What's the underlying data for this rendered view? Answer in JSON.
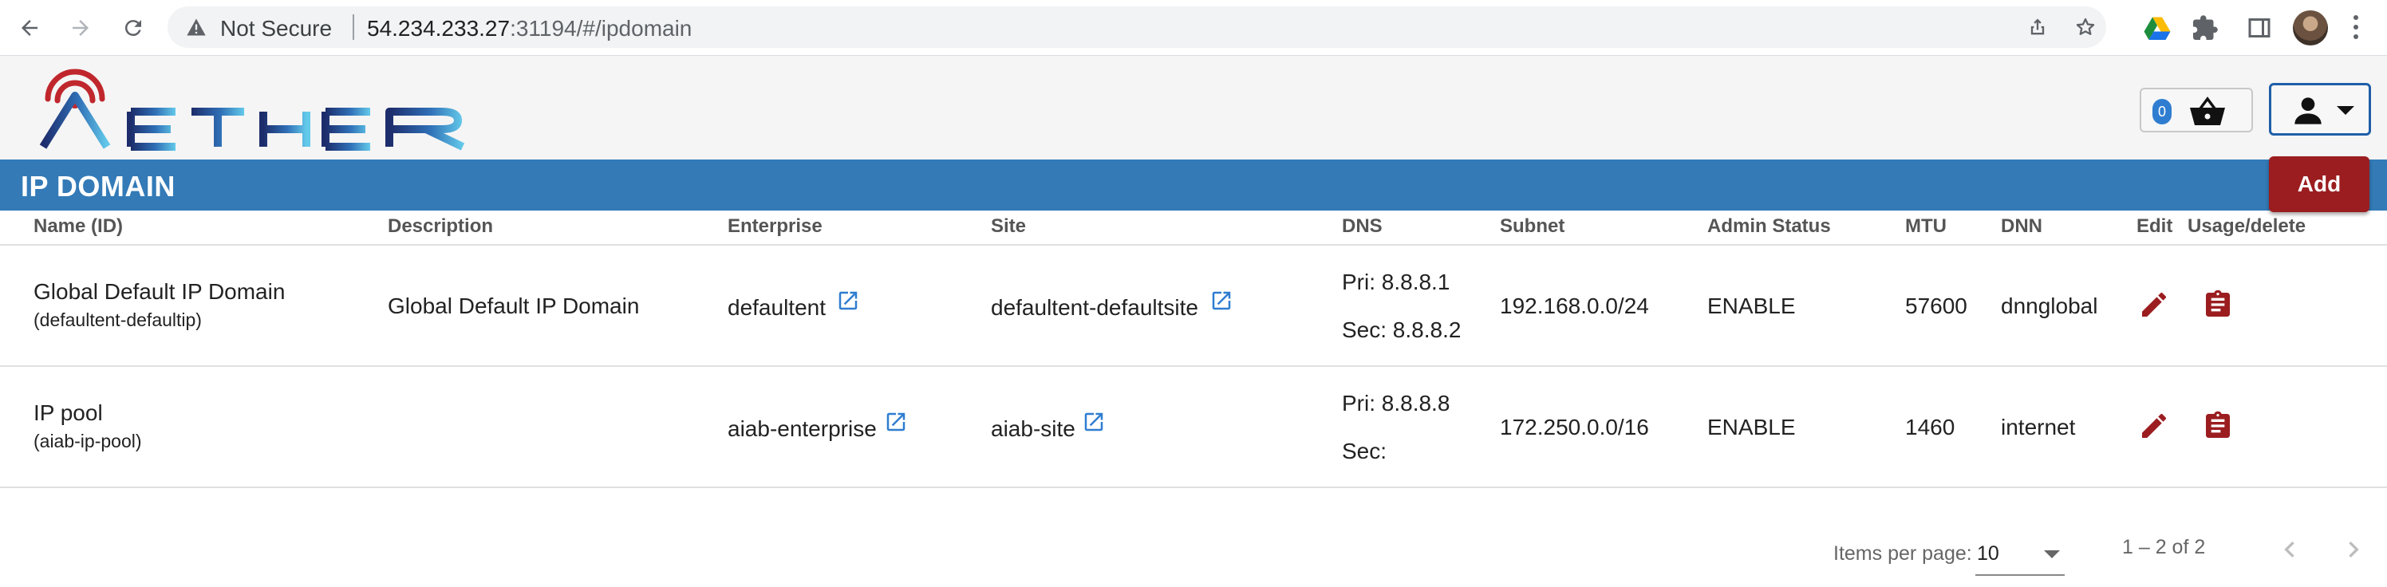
{
  "browser": {
    "security_label": "Not Secure",
    "url_host": "54.234.233.27",
    "url_rest": ":31194/#/ipdomain"
  },
  "header": {
    "logo_text": "AETHER",
    "cart_count": "0"
  },
  "page": {
    "title": "IP DOMAIN",
    "add_label": "Add"
  },
  "table": {
    "columns": {
      "name": "Name (ID)",
      "description": "Description",
      "enterprise": "Enterprise",
      "site": "Site",
      "dns": "DNS",
      "subnet": "Subnet",
      "admin_status": "Admin Status",
      "mtu": "MTU",
      "dnn": "DNN",
      "edit": "Edit",
      "usage": "Usage/delete"
    },
    "rows": [
      {
        "name": "Global Default IP Domain",
        "id": "(defaultent-defaultip)",
        "description": "Global Default IP Domain",
        "enterprise": "defaultent",
        "site": "defaultent-defaultsite",
        "dns_primary": "Pri: 8.8.8.1",
        "dns_secondary": "Sec: 8.8.8.2",
        "subnet": "192.168.0.0/24",
        "admin_status": "ENABLE",
        "mtu": "57600",
        "dnn": "dnnglobal"
      },
      {
        "name": "IP pool",
        "id": "(aiab-ip-pool)",
        "description": "",
        "enterprise": "aiab-enterprise",
        "site": "aiab-site",
        "dns_primary": "Pri: 8.8.8.8",
        "dns_secondary": "Sec:",
        "subnet": "172.250.0.0/16",
        "admin_status": "ENABLE",
        "mtu": "1460",
        "dnn": "internet"
      }
    ]
  },
  "pagination": {
    "items_per_page_label": "Items per page:",
    "items_per_page_value": "10",
    "range_label": "1 – 2 of 2"
  },
  "colors": {
    "title_bar": "#337ab7",
    "add_button": "#9b1d20",
    "action_icon": "#9b1d20",
    "link_icon": "#2f7dd0"
  }
}
